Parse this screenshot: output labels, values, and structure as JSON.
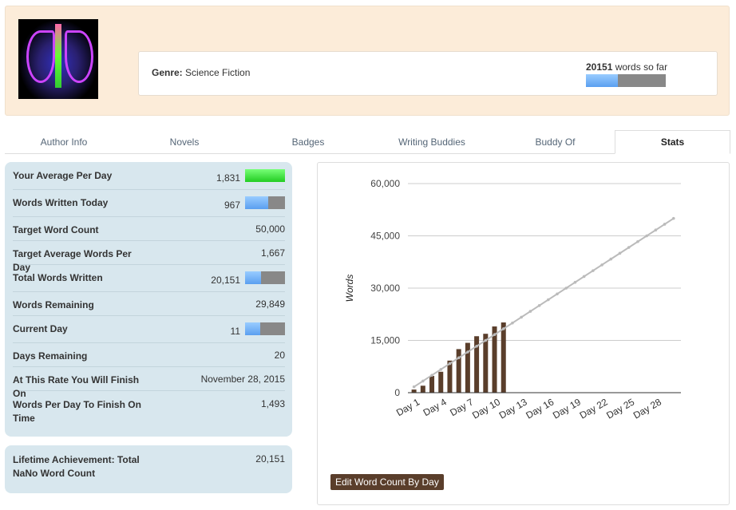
{
  "header": {
    "genre_label": "Genre:",
    "genre": "Science Fiction",
    "word_count": "20151",
    "word_count_suffix": "words so far",
    "progress": 0.4
  },
  "tabs": [
    {
      "label": "Author Info"
    },
    {
      "label": "Novels"
    },
    {
      "label": "Badges"
    },
    {
      "label": "Writing Buddies"
    },
    {
      "label": "Buddy Of"
    },
    {
      "label": "Stats",
      "active": true
    }
  ],
  "stats": [
    {
      "label": "Your Average Per Day",
      "value": "1,831",
      "bar": 1.0,
      "bar_color": "green"
    },
    {
      "label": "Words Written Today",
      "value": "967",
      "bar": 0.58
    },
    {
      "label": "Target Word Count",
      "value": "50,000"
    },
    {
      "label": "Target Average Words Per Day",
      "value": "1,667"
    },
    {
      "label": "Total Words Written",
      "value": "20,151",
      "bar": 0.4
    },
    {
      "label": "Words Remaining",
      "value": "29,849"
    },
    {
      "label": "Current Day",
      "value": "11",
      "bar": 0.37
    },
    {
      "label": "Days Remaining",
      "value": "20"
    },
    {
      "label": "At This Rate You Will Finish On",
      "value": "November 28, 2015"
    },
    {
      "label": "Words Per Day To Finish On Time",
      "value": "1,493"
    }
  ],
  "lifetime": {
    "label": "Lifetime Achievement: Total NaNo Word Count",
    "value": "20,151"
  },
  "edit_button": "Edit Word Count By Day",
  "chart_data": {
    "type": "bar",
    "ylabel": "Words",
    "ylim": [
      0,
      60000
    ],
    "yticks": [
      "0",
      "15,000",
      "30,000",
      "45,000",
      "60,000"
    ],
    "ytick_values": [
      0,
      15000,
      30000,
      45000,
      60000
    ],
    "xtick_labels": [
      "Day 1",
      "Day 4",
      "Day 7",
      "Day 10",
      "Day 13",
      "Day 16",
      "Day 19",
      "Day 22",
      "Day 25",
      "Day 28"
    ],
    "days": 30,
    "series": [
      {
        "name": "Words",
        "type": "bar",
        "color": "#5a3e2b",
        "values": [
          900,
          2000,
          4800,
          6000,
          9200,
          12500,
          14300,
          16200,
          16900,
          19000,
          20151
        ]
      },
      {
        "name": "Target",
        "type": "line",
        "color": "#bbbbbb",
        "start": 1667,
        "end": 50000
      }
    ]
  }
}
